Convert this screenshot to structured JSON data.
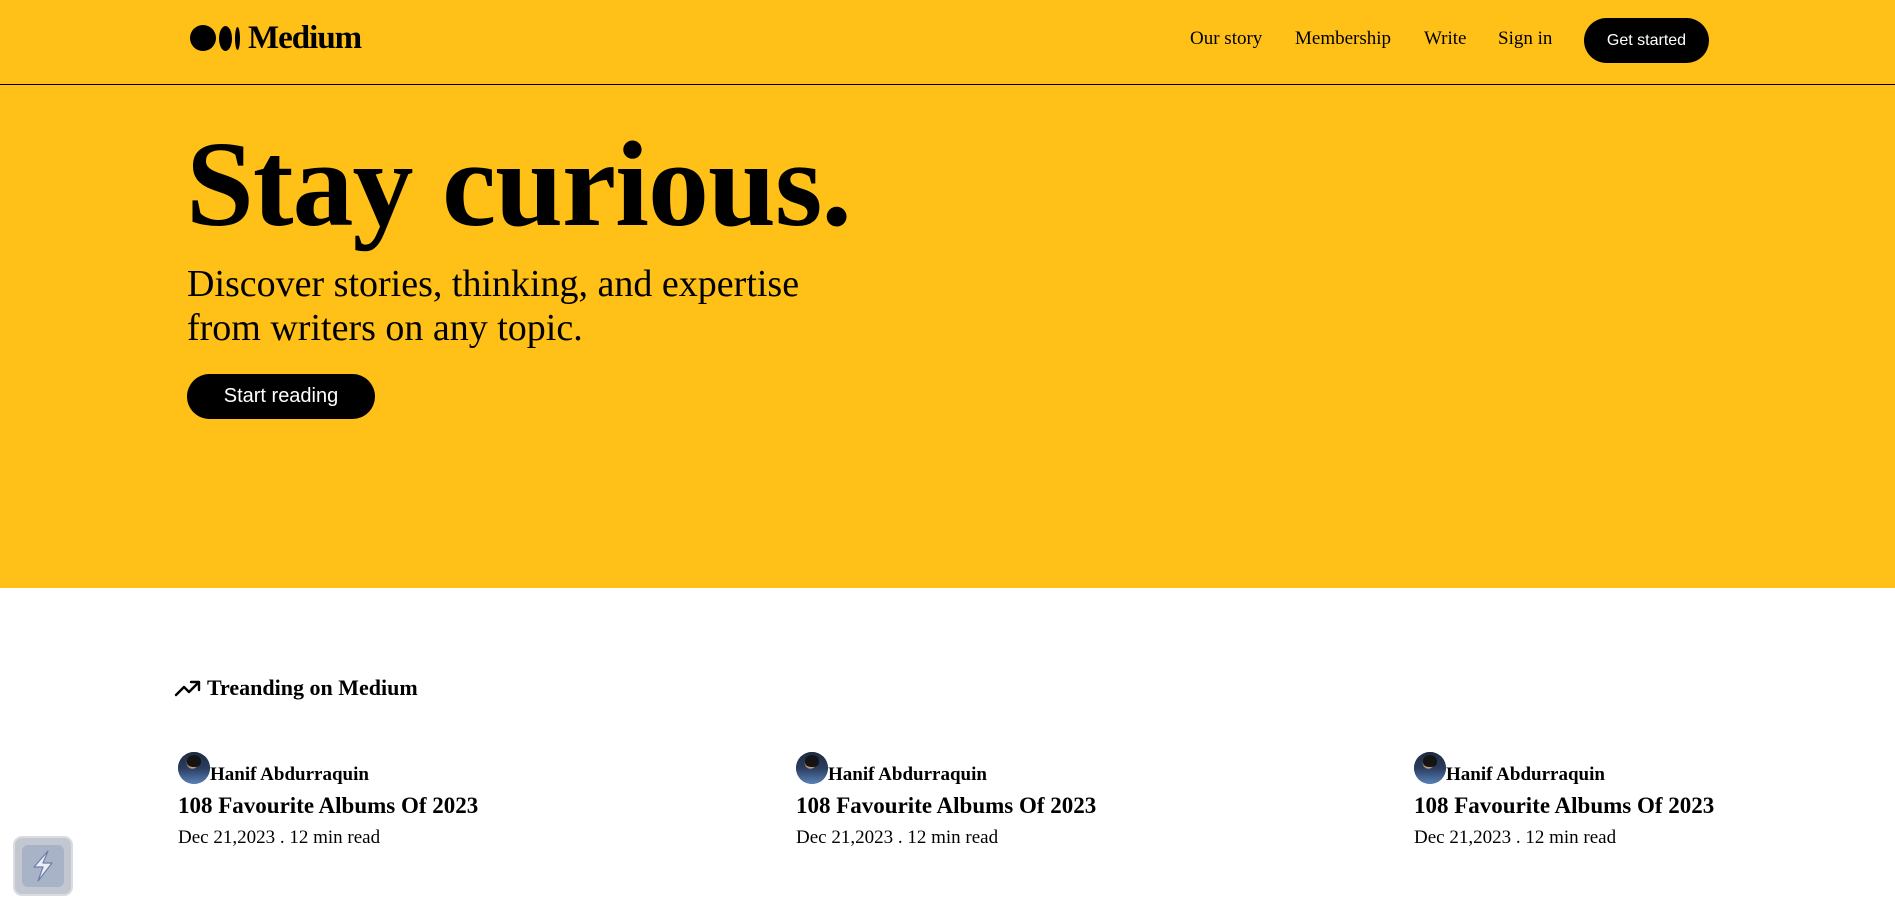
{
  "brand": {
    "name": "Medium"
  },
  "nav": {
    "our_story": "Our story",
    "membership": "Membership",
    "write": "Write",
    "sign_in": "Sign in",
    "get_started": "Get started"
  },
  "hero": {
    "title": "Stay curious.",
    "subtitle": "Discover stories, thinking, and expertise from writers on any topic.",
    "cta": "Start reading"
  },
  "trending": {
    "title": "Treanding on Medium",
    "icon": "trending-up-icon",
    "articles": [
      {
        "author": "Hanif Abdurraquin",
        "title": "108 Favourite Albums Of 2023",
        "meta": "Dec 21,2023 . 12 min read"
      },
      {
        "author": "Hanif Abdurraquin",
        "title": "108 Favourite Albums Of 2023",
        "meta": "Dec 21,2023 . 12 min read"
      },
      {
        "author": "Hanif Abdurraquin",
        "title": "108 Favourite Albums Of 2023",
        "meta": "Dec 21,2023 . 12 min read"
      }
    ]
  },
  "colors": {
    "hero_bg": "#FFC017",
    "button_bg": "#000000",
    "button_text": "#FFFFFF",
    "page_bg": "#FFFFFF"
  }
}
